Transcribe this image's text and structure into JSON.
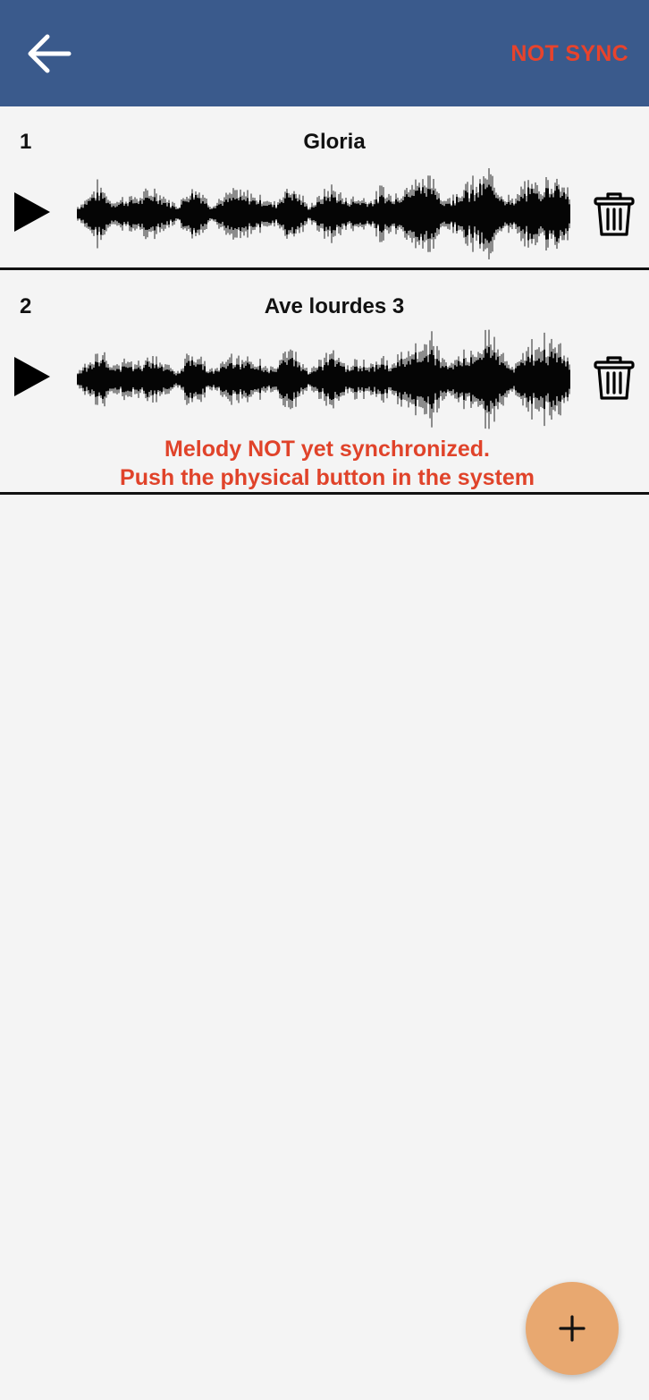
{
  "header": {
    "back_icon": "arrow-left-icon",
    "sync_status": "NOT SYNC",
    "background_color": "#3a5a8c",
    "status_color": "#e8432c"
  },
  "melodies": [
    {
      "index": "1",
      "title": "Gloria"
    },
    {
      "index": "2",
      "title": "Ave lourdes 3",
      "warning_line1": "Melody NOT yet synchronized.",
      "warning_line2": "Push the physical button in the system"
    }
  ],
  "fab": {
    "icon": "plus-icon",
    "color": "#e8a870"
  }
}
